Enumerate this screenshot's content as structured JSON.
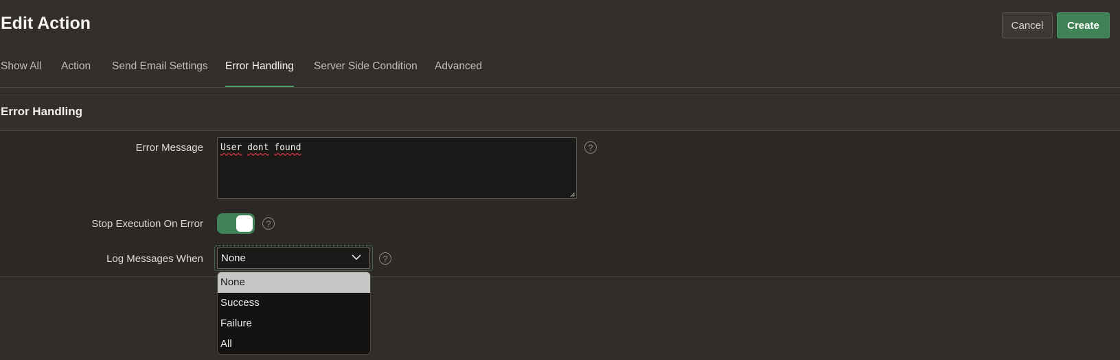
{
  "header": {
    "title": "Edit Action",
    "cancel_label": "Cancel",
    "create_label": "Create"
  },
  "tabs": [
    {
      "label": "Show All",
      "active": false
    },
    {
      "label": "Action",
      "active": false
    },
    {
      "label": "Send Email Settings",
      "active": false
    },
    {
      "label": "Error Handling",
      "active": true
    },
    {
      "label": "Server Side Condition",
      "active": false
    },
    {
      "label": "Advanced",
      "active": false
    }
  ],
  "region": {
    "title": "Error Handling",
    "error_message": {
      "label": "Error Message",
      "value_words": [
        "User",
        "dont",
        "found"
      ],
      "value": "User dont found"
    },
    "stop_execution": {
      "label": "Stop Execution On Error",
      "on": true
    },
    "log_messages": {
      "label": "Log Messages When",
      "selected": "None",
      "options": [
        "None",
        "Success",
        "Failure",
        "All"
      ]
    }
  },
  "help_icon": "?",
  "colors": {
    "accent": "#3f8256",
    "background": "#2e2b28",
    "field": "#1b1918",
    "selected_option": "#c6c6c6"
  }
}
